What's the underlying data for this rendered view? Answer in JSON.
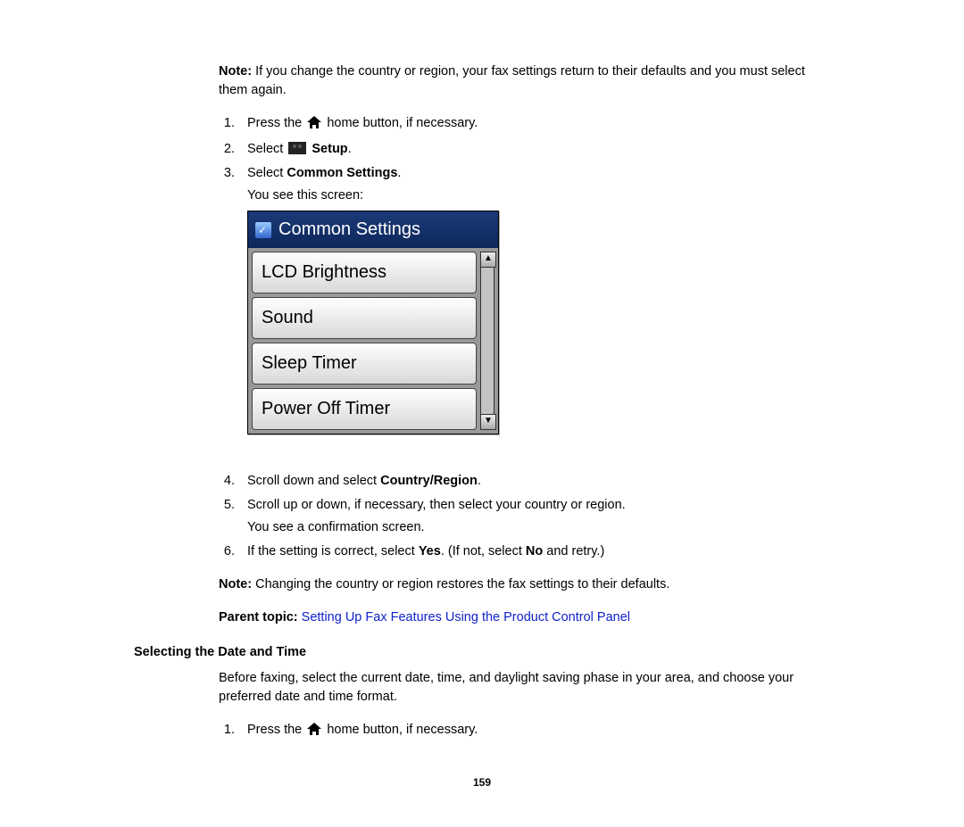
{
  "note_intro_bold": "Note:",
  "note_intro_text": " If you change the country or region, your fax settings return to their defaults and you must select them again.",
  "steps_a": [
    {
      "num": "1.",
      "pre": "Press the ",
      "mid": " home button, if necessary."
    },
    {
      "num": "2.",
      "pre": "Select ",
      "bold": "Setup",
      "post": "."
    },
    {
      "num": "3.",
      "pre": "Select ",
      "bold": "Common Settings",
      "post": ".",
      "follow": "You see this screen:"
    }
  ],
  "lcd": {
    "title": "Common Settings",
    "items": [
      "LCD Brightness",
      "Sound",
      "Sleep Timer",
      "Power Off Timer"
    ]
  },
  "steps_b": [
    {
      "num": "4.",
      "pre": "Scroll down and select ",
      "bold": "Country/Region",
      "post": "."
    },
    {
      "num": "5.",
      "pre": "Scroll up or down, if necessary, then select your country or region.",
      "follow": "You see a confirmation screen."
    },
    {
      "num": "6.",
      "pre": "If the setting is correct, select ",
      "bold": "Yes",
      "post": ". (If not, select ",
      "bold2": "No",
      "post2": " and retry.)"
    }
  ],
  "note2_bold": "Note:",
  "note2_text": " Changing the country or region restores the fax settings to their defaults.",
  "parent_topic_label": "Parent topic:",
  "parent_topic_link": "Setting Up Fax Features Using the Product Control Panel",
  "section_heading": "Selecting the Date and Time",
  "section_text": "Before faxing, select the current date, time, and daylight saving phase in your area, and choose your preferred date and time format.",
  "steps_c": [
    {
      "num": "1.",
      "pre": "Press the ",
      "mid": " home button, if necessary."
    }
  ],
  "page_number": "159"
}
